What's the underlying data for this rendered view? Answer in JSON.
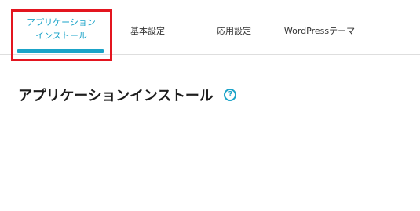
{
  "tabs": {
    "app_install": {
      "line1": "アプリケーション",
      "line2": "インストール",
      "active": true
    },
    "basic_settings": {
      "label": "基本設定"
    },
    "app_settings": {
      "label": "応用設定"
    },
    "wp_theme": {
      "label": "WordPressテーマ"
    }
  },
  "main": {
    "title": "アプリケーションインストール",
    "help_icon": "question-circle-icon",
    "help_glyph": "?"
  },
  "colors": {
    "accent": "#1aa3c8",
    "highlight": "#e3151f",
    "text": "#1e1e1e",
    "divider": "#dedede"
  }
}
